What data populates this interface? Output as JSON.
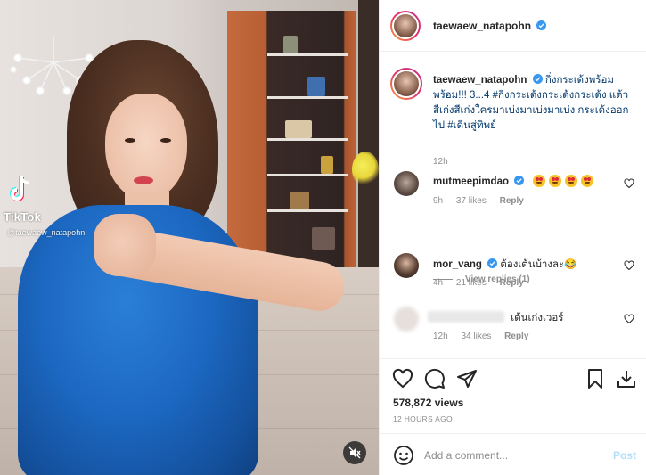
{
  "post": {
    "author": "taewaew_natapohn",
    "verified": true
  },
  "media": {
    "watermark_name": "TikTok",
    "watermark_handle": "@taewaew_natapohn",
    "mute_icon": "speaker-muted-icon"
  },
  "caption": {
    "username": "taewaew_natapohn",
    "text": "กิ่งกระเด้งพร้อม พร้อม!!! 3...4 #กิ่งกระเด้งกระเด้งกระเด้ง แต้วสีเก่งสีเก่งใครมาเบ่งมาเบ่งมาเบ่ง กระเด้งออกไป #เดินสู่ทิพย์",
    "time": "12h"
  },
  "comments": [
    {
      "username": "mutmeepimdao",
      "verified": true,
      "text": "",
      "emoji_count": 4,
      "time": "9h",
      "likes": "37 likes",
      "reply": "Reply"
    },
    {
      "username": "mor_vang",
      "verified": true,
      "text": "ต้องเต้นบ้างละ😂",
      "time": "4h",
      "likes": "21 likes",
      "reply": "Reply"
    },
    {
      "username": "",
      "verified": false,
      "text": "เต้นเก่งเวอร์",
      "time": "12h",
      "likes": "34 likes",
      "reply": "Reply"
    }
  ],
  "view_replies": "View replies (1)",
  "actions": {
    "views": "578,872 views",
    "post_time": "12 HOURS AGO",
    "icons": [
      "heart-icon",
      "comment-icon",
      "share-icon",
      "bookmark-icon",
      "download-icon"
    ]
  },
  "add_comment": {
    "placeholder": "Add a comment...",
    "post_label": "Post"
  },
  "colors": {
    "verified_blue": "#3897f0",
    "hashtag": "#00376b",
    "post_disabled": "#b2dffc"
  }
}
